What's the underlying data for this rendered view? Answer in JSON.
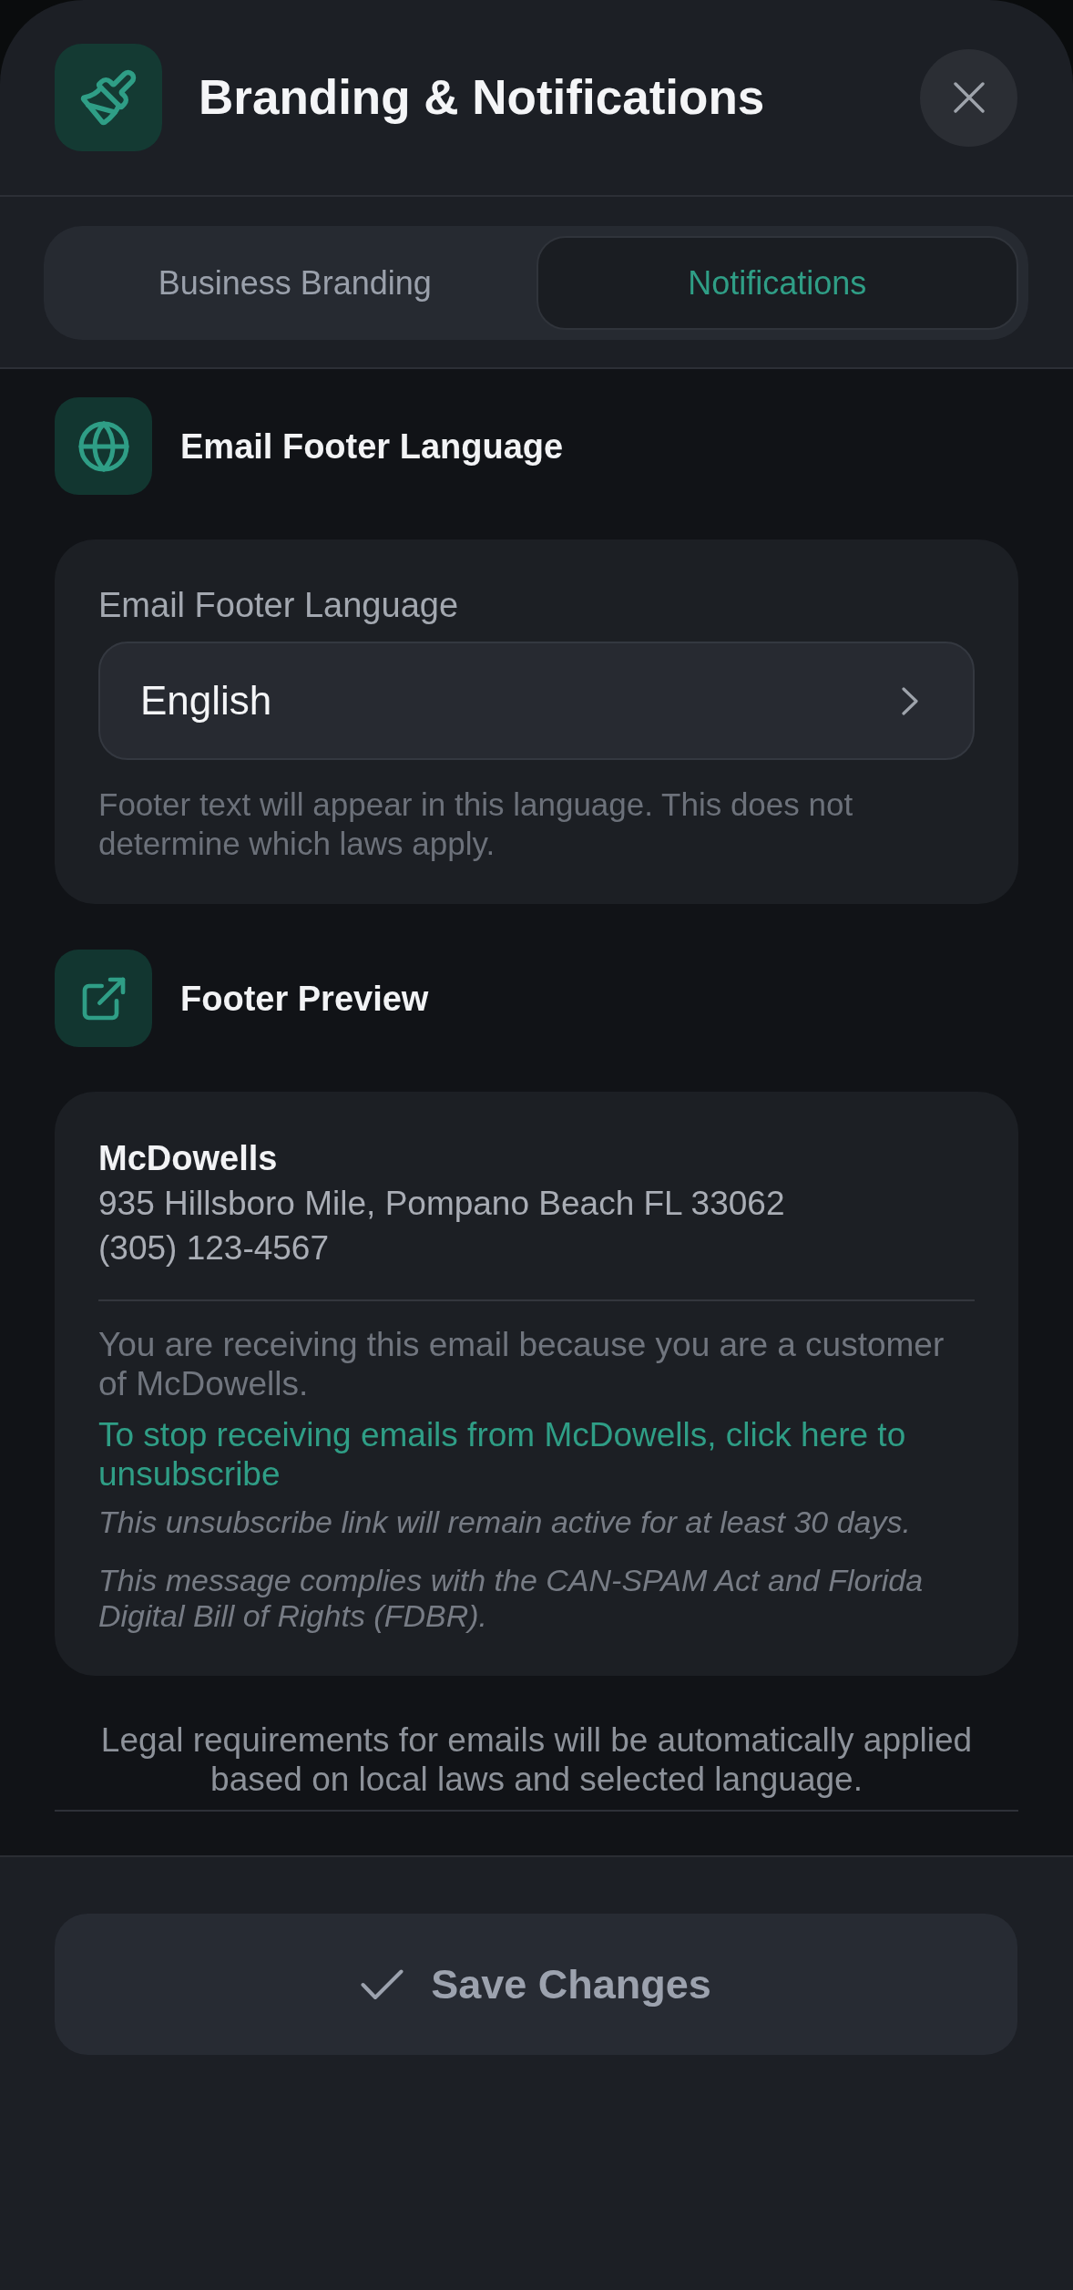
{
  "header": {
    "title": "Branding & Notifications"
  },
  "tabs": [
    {
      "label": "Business Branding",
      "selected": false
    },
    {
      "label": "Notifications",
      "selected": true
    }
  ],
  "sections": [
    {
      "kind": "language",
      "title": "Email Footer Language",
      "field": {
        "label": "Email Footer Language",
        "value": "English"
      },
      "help": "Footer text will appear in this language. This does not determine which laws apply."
    },
    {
      "kind": "preview",
      "title": "Footer Preview",
      "preview": {
        "business_name": "McDowells",
        "address": "935 Hillsboro Mile, Pompano Beach FL 33062",
        "phone": "(305) 123-4567",
        "notice": "You are receiving this email because you are a customer of McDowells.",
        "unsubscribe_link": "To stop receiving emails from McDowells, click here to unsubscribe",
        "link_note": "This unsubscribe link will remain active for at least 30 days.",
        "compliance": "This message complies with the CAN-SPAM Act and Florida Digital Bill of Rights (FDBR)."
      }
    }
  ],
  "legal_note": "Legal requirements for emails will be automatically applied based on local laws and selected language.",
  "save_button": {
    "label": "Save Changes"
  }
}
